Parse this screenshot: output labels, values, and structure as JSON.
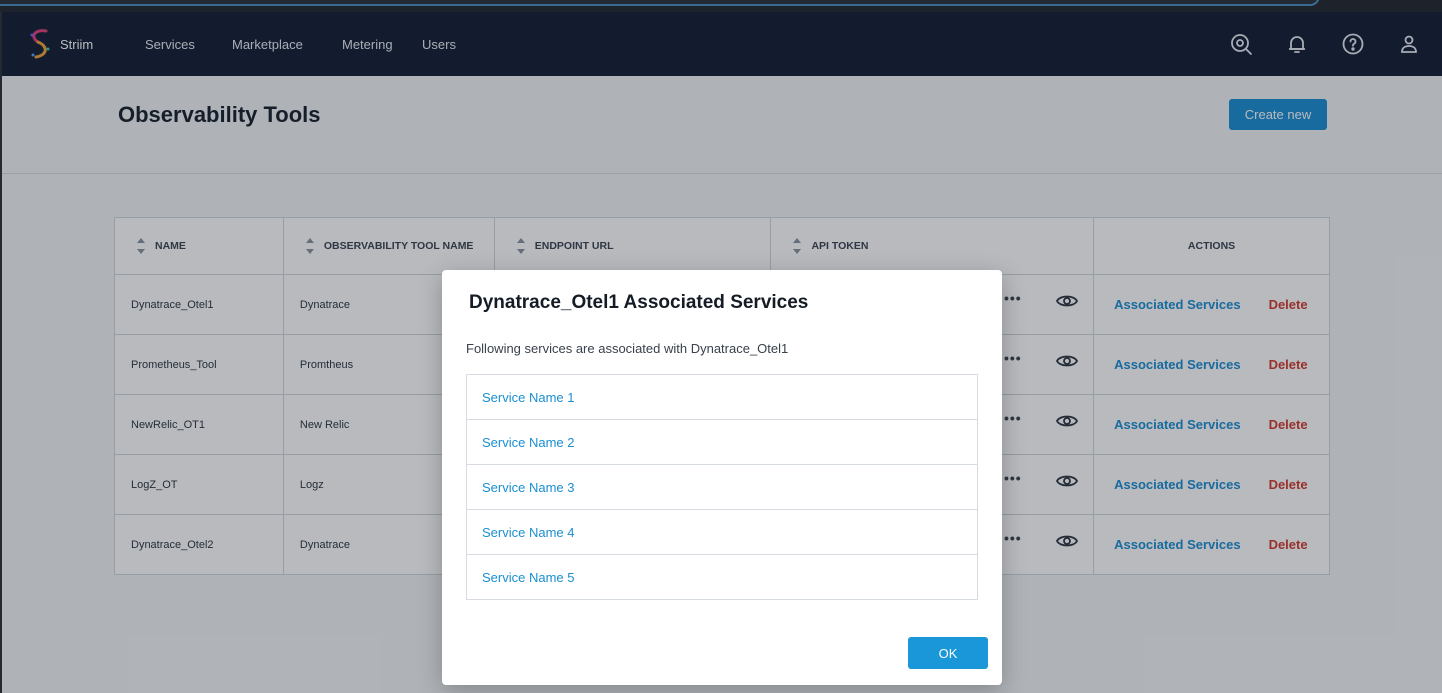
{
  "navbar": {
    "brand": "Striim",
    "items": [
      {
        "label": "Services"
      },
      {
        "label": "Marketplace"
      },
      {
        "label": "Metering"
      },
      {
        "label": "Users"
      }
    ],
    "icons": [
      "observability-icon",
      "bell-icon",
      "help-icon",
      "user-icon"
    ]
  },
  "page": {
    "title": "Observability Tools",
    "create_label": "Create new"
  },
  "table": {
    "headers": [
      "NAME",
      "OBSERVABILITY TOOL NAME",
      "ENDPOINT URL",
      "API TOKEN",
      "ACTIONS"
    ],
    "rows": [
      {
        "name": "Dynatrace_Otel1",
        "tool": "Dynatrace"
      },
      {
        "name": "Prometheus_Tool",
        "tool": "Promtheus"
      },
      {
        "name": "NewRelic_OT1",
        "tool": "New Relic"
      },
      {
        "name": "LogZ_OT",
        "tool": "Logz"
      },
      {
        "name": "Dynatrace_Otel2",
        "tool": "Dynatrace"
      }
    ],
    "token_mask": "•••",
    "assoc_label": "Associated Services",
    "delete_label": "Delete"
  },
  "modal": {
    "title": "Dynatrace_Otel1 Associated Services",
    "description": "Following services are associated with Dynatrace_Otel1",
    "services": [
      "Service Name 1",
      "Service Name 2",
      "Service Name 3",
      "Service Name 4",
      "Service Name 5"
    ],
    "ok_label": "OK"
  },
  "colors": {
    "navbar": "#131d33",
    "accent": "#1a8fd2",
    "danger": "#d33b2c"
  }
}
